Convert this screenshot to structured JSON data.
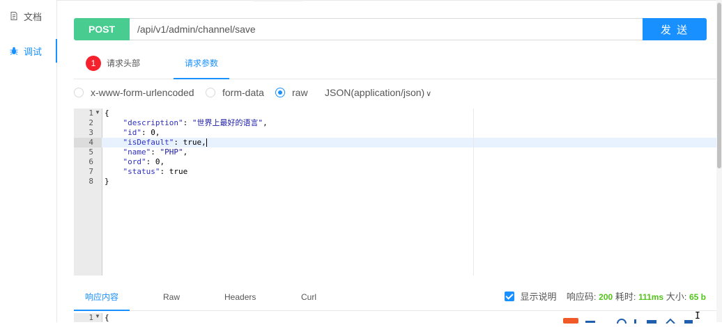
{
  "sidebar": {
    "items": [
      {
        "label": "文档",
        "icon": "document-icon"
      },
      {
        "label": "调试",
        "icon": "bug-icon"
      }
    ]
  },
  "request": {
    "method": "POST",
    "url": "/api/v1/admin/channel/save",
    "send_label": "发 送"
  },
  "tabs": {
    "badge": "1",
    "headers_label": "请求头部",
    "params_label": "请求参数"
  },
  "body_types": {
    "urlencoded": "x-www-form-urlencoded",
    "formdata": "form-data",
    "raw": "raw",
    "content_type": "JSON(application/json)"
  },
  "editor": {
    "line_numbers": [
      "1",
      "2",
      "3",
      "4",
      "5",
      "6",
      "7",
      "8"
    ]
  },
  "response": {
    "tab_content": "响应内容",
    "tab_raw": "Raw",
    "tab_headers": "Headers",
    "tab_curl": "Curl",
    "show_desc_label": "显示说明",
    "code_label": "响应码:",
    "code_value": "200",
    "time_label": "耗时:",
    "time_value": "111ms",
    "size_label": "大小:",
    "size_value": "65 b",
    "first_line_number": "1",
    "first_line": "{"
  },
  "colors": {
    "accent": "#1890ff",
    "method": "#49cc90",
    "badge": "#f5222d",
    "success": "#52c41a"
  }
}
